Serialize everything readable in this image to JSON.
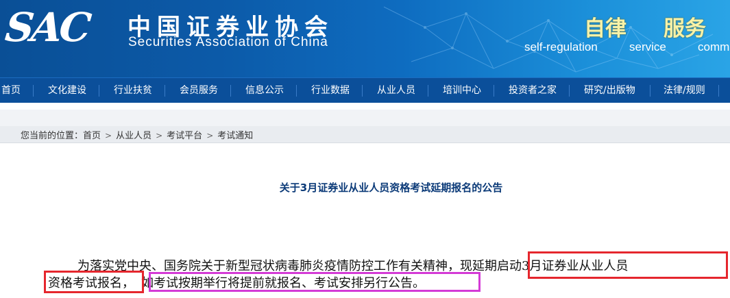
{
  "header": {
    "logo": "SAC",
    "name_cn": "中国证券业协会",
    "name_en": "Securities Association of China",
    "motto": [
      "自律",
      "服务"
    ],
    "motto_en": [
      "self-regulation",
      "service",
      "comm"
    ]
  },
  "nav": {
    "items": [
      "首页",
      "文化建设",
      "行业扶贫",
      "会员服务",
      "信息公示",
      "行业数据",
      "从业人员",
      "培训中心",
      "投资者之家",
      "研究/出版物",
      "法律/规则"
    ]
  },
  "breadcrumb": {
    "prefix": "您当前的位置：",
    "items": [
      "首页",
      "从业人员",
      "考试平台",
      "考试通知"
    ]
  },
  "article": {
    "title": "关于3月证券业从业人员资格考试延期报名的公告",
    "line1_a": "为落实党中央、国务院关于新型冠状病毒肺炎疫情防控工作有关精神，",
    "line1_b": "现延期启动3月证券业从业人员",
    "line2_a": "资格考试报名，",
    "line2_b": "如考试按期举行将提前就报名、考试安排另行公告。"
  },
  "colors": {
    "header_blue": "#0c5aa8",
    "nav_blue": "#0b4f9a",
    "title_blue": "#0b3a78",
    "highlight_red": "#e5262d",
    "highlight_magenta": "#d43ad6",
    "motto_yellow": "#f8f2a8"
  }
}
